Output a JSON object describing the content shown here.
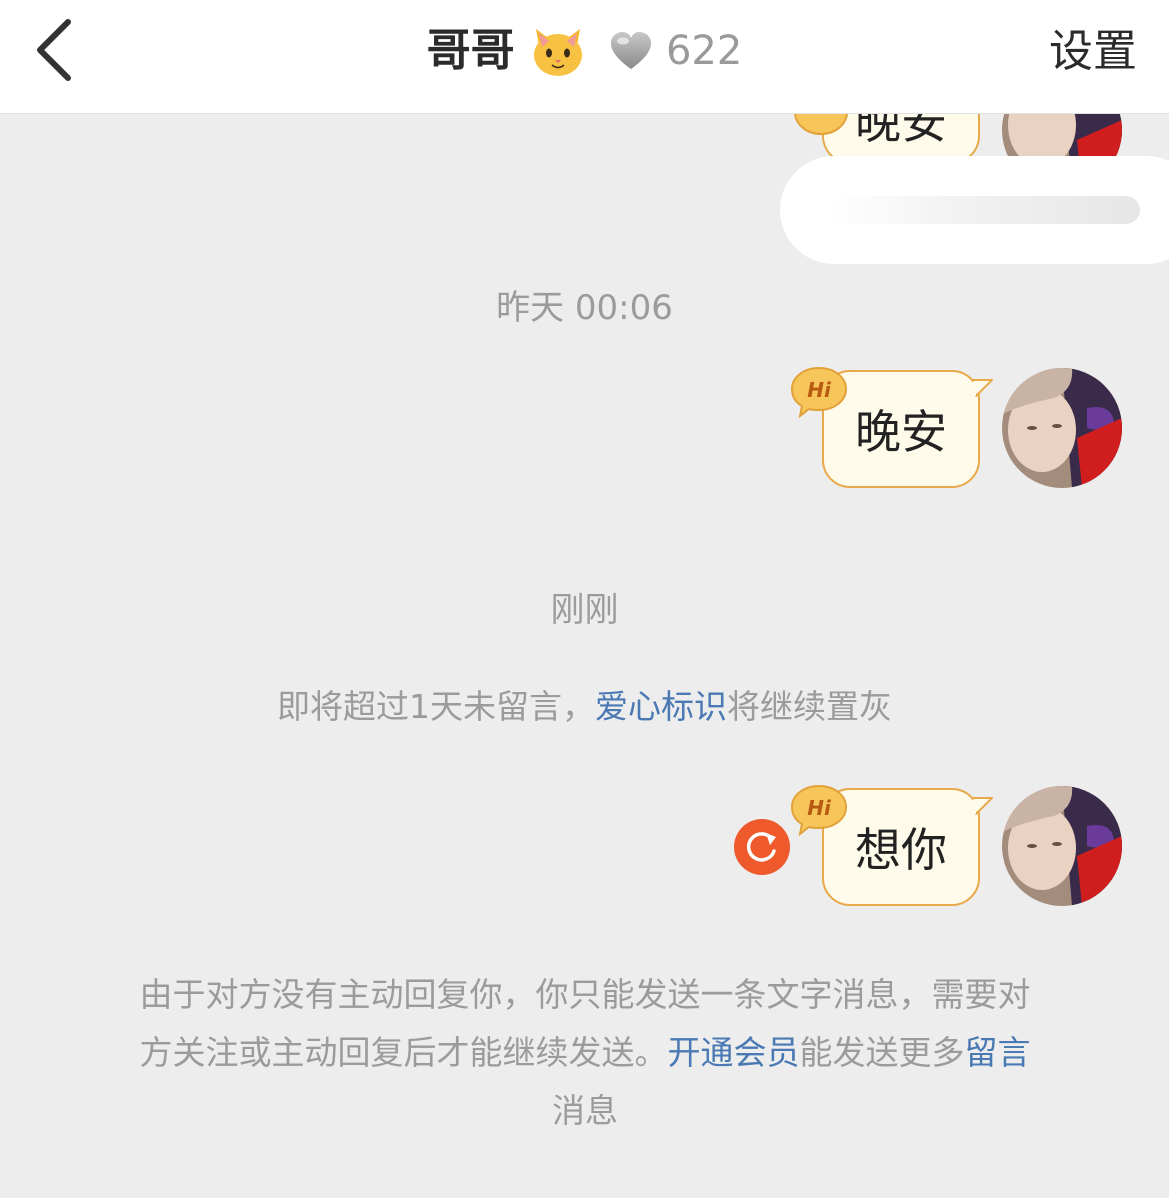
{
  "header": {
    "title": "哥哥",
    "emoji": "cat-face-emoji",
    "heart_icon": "grey-heart-icon",
    "heart_count": "622",
    "settings_label": "设置",
    "back_icon": "chevron-left-icon"
  },
  "messages": [
    {
      "id": "msg-top",
      "text": "晚安",
      "sender": "self",
      "badge": "Hi",
      "partial": true
    },
    {
      "id": "msg-1",
      "text": "晚安",
      "sender": "self",
      "badge": "Hi"
    },
    {
      "id": "msg-2",
      "text": "想你",
      "sender": "self",
      "badge": "Hi",
      "status": "failed"
    }
  ],
  "timestamps": {
    "yesterday": "昨天 00:06",
    "just_now": "刚刚"
  },
  "notices": {
    "heart_warning_before": "即将超过1天未留言，",
    "heart_warning_link": "爱心标识",
    "heart_warning_after": "将继续置灰",
    "limit_part1": "由于对方没有主动回复你，你只能发送一条文字消息，需要对方关注或主动回复后才能继续发送。",
    "limit_link1": "开通会员",
    "limit_part2": "能发送更多",
    "limit_link2": "留言",
    "limit_part3": "消息"
  },
  "colors": {
    "background": "#ededed",
    "bubble_fill": "#fffbea",
    "bubble_border": "#e8a94a",
    "link": "#4a79b4",
    "retry": "#ee5a2c",
    "badge": "#f7c65a"
  }
}
